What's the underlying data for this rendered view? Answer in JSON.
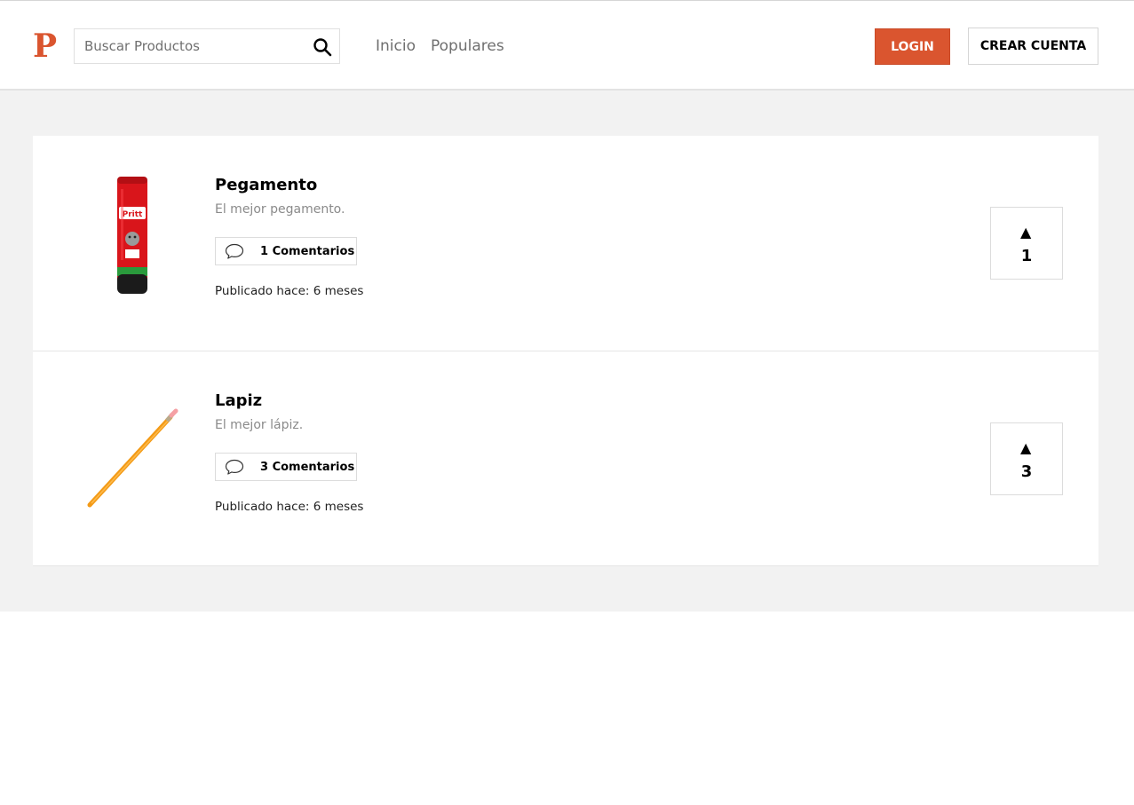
{
  "header": {
    "logo_letter": "P",
    "search": {
      "placeholder": "Buscar Productos",
      "value": ""
    },
    "nav": [
      {
        "label": "Inicio"
      },
      {
        "label": "Populares"
      }
    ],
    "login_label": "LOGIN",
    "signup_label": "CREAR CUENTA",
    "accent_color": "#da552f"
  },
  "products": [
    {
      "name": "Pegamento",
      "description": "El mejor pegamento.",
      "comments_label": "1 Comentarios",
      "published": "Publicado hace: 6 meses",
      "votes": "1",
      "vote_arrow": "▲",
      "image_icon": "glue-stick-image",
      "image_brand_text": "Pritt"
    },
    {
      "name": "Lapiz",
      "description": "El mejor lápiz.",
      "comments_label": "3 Comentarios",
      "published": "Publicado hace: 6 meses",
      "votes": "3",
      "vote_arrow": "▲",
      "image_icon": "pencil-image"
    }
  ]
}
